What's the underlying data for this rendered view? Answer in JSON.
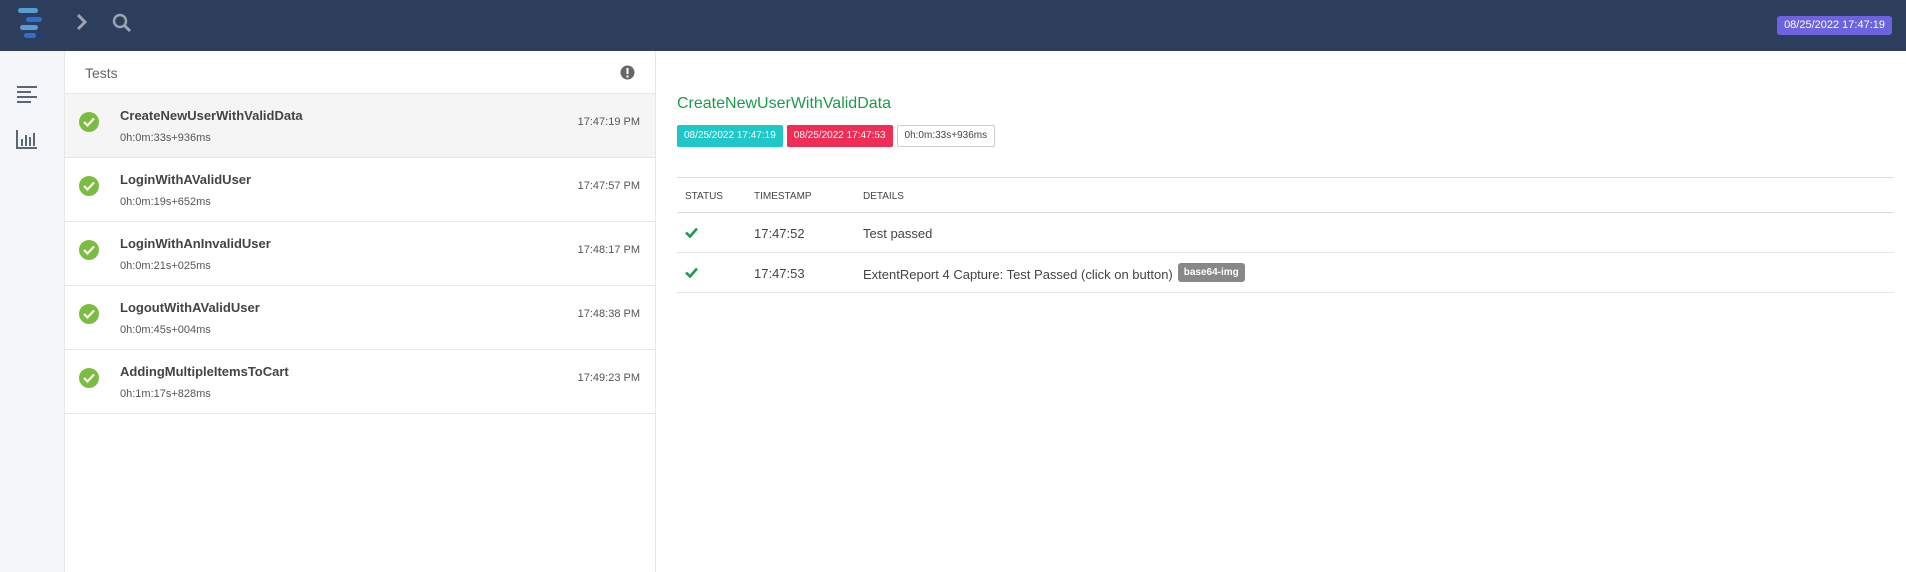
{
  "topbar": {
    "date": "08/25/2022 17:47:19"
  },
  "panel": {
    "title": "Tests"
  },
  "tests": [
    {
      "name": "CreateNewUserWithValidData",
      "duration": "0h:0m:33s+936ms",
      "time": "17:47:19 PM"
    },
    {
      "name": "LoginWithAValidUser",
      "duration": "0h:0m:19s+652ms",
      "time": "17:47:57 PM"
    },
    {
      "name": "LoginWithAnInvalidUser",
      "duration": "0h:0m:21s+025ms",
      "time": "17:48:17 PM"
    },
    {
      "name": "LogoutWithAValidUser",
      "duration": "0h:0m:45s+004ms",
      "time": "17:48:38 PM"
    },
    {
      "name": "AddingMultipleItemsToCart",
      "duration": "0h:1m:17s+828ms",
      "time": "17:49:23 PM"
    }
  ],
  "detail": {
    "title": "CreateNewUserWithValidData",
    "start": "08/25/2022 17:47:19",
    "end": "08/25/2022 17:47:53",
    "duration": "0h:0m:33s+936ms",
    "columns": {
      "status": "STATUS",
      "timestamp": "TIMESTAMP",
      "details": "DETAILS"
    },
    "logs": [
      {
        "timestamp": "17:47:52",
        "details": "Test passed",
        "badge": ""
      },
      {
        "timestamp": "17:47:53",
        "details": "ExtentReport 4 Capture: Test Passed (click on button)",
        "badge": "base64-img"
      }
    ]
  },
  "colors": {
    "topbar": "#2c3e5b",
    "pass": "#7dbb42",
    "title_green": "#1a9c48",
    "start_badge": "#1ec8c8",
    "end_badge": "#f02d55",
    "date_badge": "#6c63e0"
  },
  "icons": {
    "logo": "extent-logo-icon",
    "nav_toggle": "chevron-right-icon",
    "search": "search-icon",
    "dashboard_list": "list-icon",
    "dashboard_chart": "bar-chart-icon",
    "info": "info-icon",
    "pass": "check-circle-icon"
  }
}
